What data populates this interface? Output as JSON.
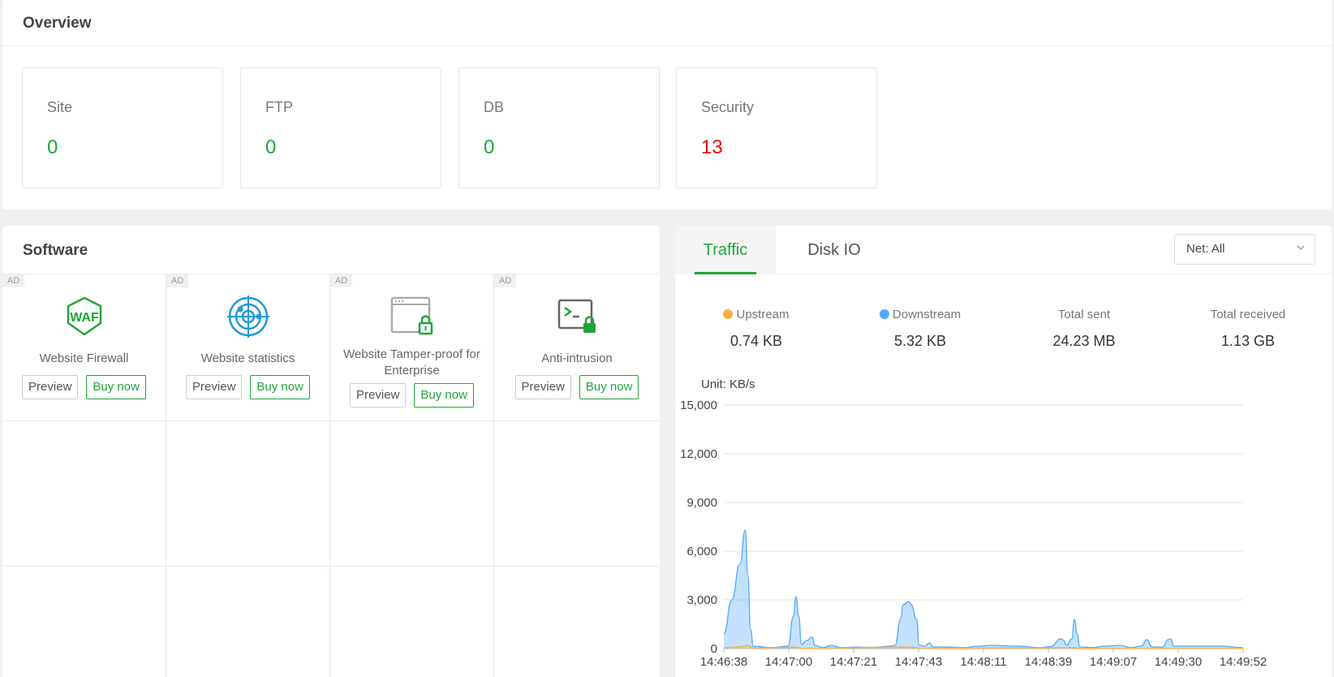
{
  "overview": {
    "title": "Overview",
    "cards": [
      {
        "label": "Site",
        "value": "0"
      },
      {
        "label": "FTP",
        "value": "0"
      },
      {
        "label": "DB",
        "value": "0"
      },
      {
        "label": "Security",
        "value": "13"
      }
    ]
  },
  "software": {
    "title": "Software",
    "ad_label": "AD",
    "items": [
      {
        "name": "Website Firewall",
        "icon": "waf-shield-icon",
        "icon_text": "WAF",
        "preview": "Preview",
        "buy": "Buy now"
      },
      {
        "name": "Website statistics",
        "icon": "target-icon",
        "preview": "Preview",
        "buy": "Buy now"
      },
      {
        "name": "Website Tamper-proof for Enterprise",
        "icon": "browser-lock-icon",
        "preview": "Preview",
        "buy": "Buy now"
      },
      {
        "name": "Anti-intrusion",
        "icon": "terminal-lock-icon",
        "preview": "Preview",
        "buy": "Buy now"
      }
    ]
  },
  "traffic": {
    "tabs": [
      "Traffic",
      "Disk IO"
    ],
    "active_tab": "Traffic",
    "net_select": "Net: All",
    "metrics": [
      {
        "label": "Upstream",
        "value": "0.74 KB",
        "dot_color": "#f7b03c"
      },
      {
        "label": "Downstream",
        "value": "5.32 KB",
        "dot_color": "#52a9ff"
      },
      {
        "label": "Total sent",
        "value": "24.23 MB"
      },
      {
        "label": "Total received",
        "value": "1.13 GB"
      }
    ]
  },
  "chart_data": {
    "type": "area",
    "unit_label": "Unit: KB/s",
    "ylim": [
      0,
      15000
    ],
    "y_ticks": [
      "0",
      "3,000",
      "6,000",
      "9,000",
      "12,000",
      "15,000"
    ],
    "x_tick_labels": [
      "14:46:38",
      "14:47:00",
      "14:47:21",
      "14:47:43",
      "14:48:11",
      "14:48:39",
      "14:49:07",
      "14:49:30",
      "14:49:52"
    ],
    "x_range": [
      0,
      194
    ],
    "grid": true,
    "series": [
      {
        "name": "Downstream",
        "color": "#52a9ff",
        "points": [
          [
            0,
            900
          ],
          [
            3,
            3000
          ],
          [
            6,
            5200
          ],
          [
            8,
            7300
          ],
          [
            9,
            4500
          ],
          [
            10,
            1200
          ],
          [
            11,
            150
          ],
          [
            18,
            60
          ],
          [
            24,
            150
          ],
          [
            26,
            2000
          ],
          [
            27,
            3200
          ],
          [
            28,
            2000
          ],
          [
            29,
            250
          ],
          [
            31,
            500
          ],
          [
            33,
            700
          ],
          [
            34,
            200
          ],
          [
            37,
            60
          ],
          [
            40,
            200
          ],
          [
            44,
            60
          ],
          [
            50,
            100
          ],
          [
            55,
            60
          ],
          [
            62,
            150
          ],
          [
            64,
            200
          ],
          [
            66,
            1800
          ],
          [
            67,
            2700
          ],
          [
            69,
            2900
          ],
          [
            70,
            2700
          ],
          [
            72,
            1800
          ],
          [
            73,
            200
          ],
          [
            75,
            150
          ],
          [
            77,
            350
          ],
          [
            78,
            100
          ],
          [
            83,
            100
          ],
          [
            90,
            60
          ],
          [
            95,
            150
          ],
          [
            100,
            200
          ],
          [
            110,
            150
          ],
          [
            118,
            60
          ],
          [
            122,
            120
          ],
          [
            126,
            600
          ],
          [
            127,
            500
          ],
          [
            128,
            200
          ],
          [
            130,
            600
          ],
          [
            131,
            1800
          ],
          [
            132,
            900
          ],
          [
            133,
            100
          ],
          [
            138,
            60
          ],
          [
            142,
            150
          ],
          [
            148,
            200
          ],
          [
            152,
            60
          ],
          [
            156,
            150
          ],
          [
            158,
            550
          ],
          [
            160,
            100
          ],
          [
            164,
            100
          ],
          [
            166,
            550
          ],
          [
            167,
            600
          ],
          [
            168,
            150
          ],
          [
            174,
            150
          ],
          [
            180,
            150
          ],
          [
            186,
            150
          ],
          [
            194,
            60
          ]
        ]
      },
      {
        "name": "Upstream",
        "color": "#f7b03c",
        "points": [
          [
            0,
            50
          ],
          [
            6,
            120
          ],
          [
            9,
            200
          ],
          [
            11,
            40
          ],
          [
            27,
            80
          ],
          [
            29,
            20
          ],
          [
            70,
            100
          ],
          [
            74,
            20
          ],
          [
            131,
            60
          ],
          [
            133,
            20
          ],
          [
            194,
            20
          ]
        ]
      }
    ]
  }
}
